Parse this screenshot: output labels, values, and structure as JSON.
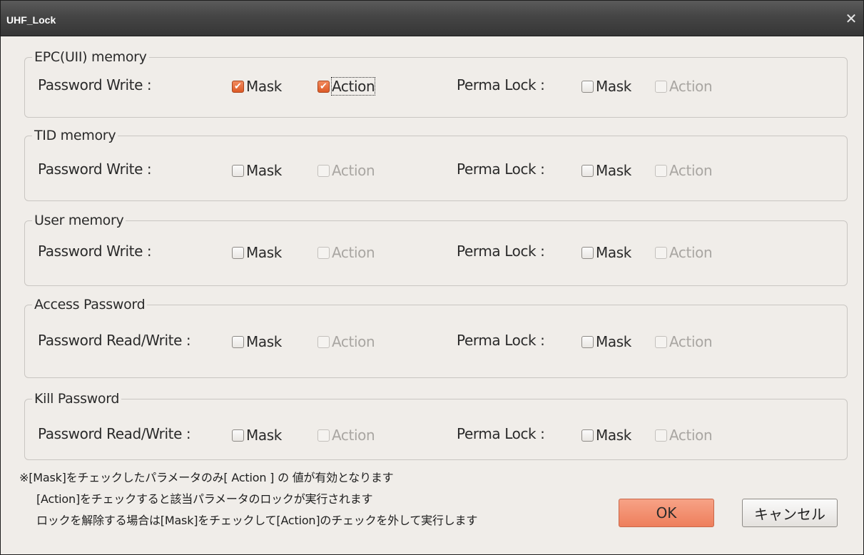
{
  "window": {
    "title": "UHF_Lock",
    "close_glyph": "✕"
  },
  "groups": [
    {
      "legend": "EPC(UII) memory",
      "row_label": "Password Write :",
      "perma_label": "Perma Lock :",
      "mask_label": "Mask",
      "action_label": "Action",
      "perma_mask_label": "Mask",
      "perma_action_label": "Action",
      "state": {
        "mask_checked": true,
        "action_checked": true,
        "action_enabled": true,
        "perma_mask_checked": false,
        "perma_action_enabled": false
      }
    },
    {
      "legend": "TID memory",
      "row_label": "Password Write :",
      "perma_label": "Perma Lock :",
      "mask_label": "Mask",
      "action_label": "Action",
      "perma_mask_label": "Mask",
      "perma_action_label": "Action",
      "state": {
        "mask_checked": false,
        "action_checked": false,
        "action_enabled": false,
        "perma_mask_checked": false,
        "perma_action_enabled": false
      }
    },
    {
      "legend": "User memory",
      "row_label": "Password Write :",
      "perma_label": "Perma Lock :",
      "mask_label": "Mask",
      "action_label": "Action",
      "perma_mask_label": "Mask",
      "perma_action_label": "Action",
      "state": {
        "mask_checked": false,
        "action_checked": false,
        "action_enabled": false,
        "perma_mask_checked": false,
        "perma_action_enabled": false
      }
    },
    {
      "legend": "Access Password",
      "row_label": "Password Read/Write :",
      "perma_label": "Perma Lock :",
      "mask_label": "Mask",
      "action_label": "Action",
      "perma_mask_label": "Mask",
      "perma_action_label": "Action",
      "state": {
        "mask_checked": false,
        "action_checked": false,
        "action_enabled": false,
        "perma_mask_checked": false,
        "perma_action_enabled": false
      }
    },
    {
      "legend": "Kill Password",
      "row_label": "Password Read/Write :",
      "perma_label": "Perma Lock :",
      "mask_label": "Mask",
      "action_label": "Action",
      "perma_mask_label": "Mask",
      "perma_action_label": "Action",
      "state": {
        "mask_checked": false,
        "action_checked": false,
        "action_enabled": false,
        "perma_mask_checked": false,
        "perma_action_enabled": false
      }
    }
  ],
  "notes": [
    "※[Mask]をチェックしたパラメータのみ[ Action ] の 値が有効となります",
    "[Action]をチェックすると該当パラメータのロックが実行されます",
    "ロックを解除する場合は[Mask]をチェックして[Action]のチェックを外して実行します"
  ],
  "buttons": {
    "ok": "OK",
    "cancel": "キャンセル"
  },
  "colors": {
    "accent": "#ee7f5c",
    "checked": "#e06b35",
    "titlebar": "#454545",
    "background": "#f0ede9"
  }
}
